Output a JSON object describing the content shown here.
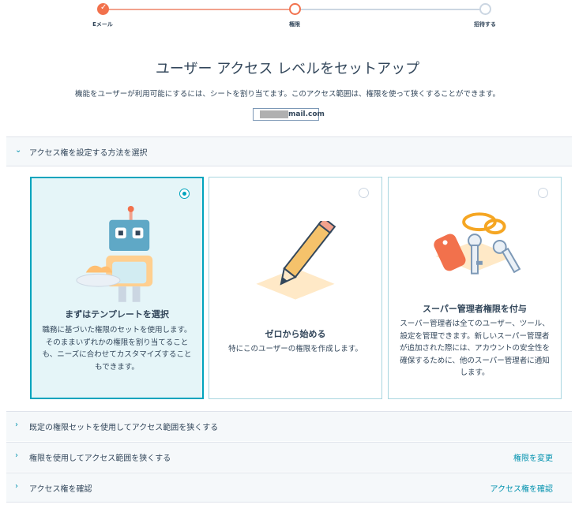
{
  "stepper": {
    "steps": [
      {
        "label": "Eメール",
        "state": "complete"
      },
      {
        "label": "権限",
        "state": "current"
      },
      {
        "label": "招待する",
        "state": "pending"
      }
    ],
    "check_glyph": "✓"
  },
  "header": {
    "title": "ユーザー アクセス レベルをセットアップ",
    "subtitle": "機能をユーザーが利用可能にするには、シートを割り当てます。このアクセス範囲は、権限を使って狭くすることができます。",
    "email": "mail.com"
  },
  "access_method_section": {
    "label": "アクセス権を設定する方法を選択",
    "chevron": "⌄"
  },
  "cards": [
    {
      "title": "まずはテンプレートを選択",
      "description": "職務に基づいた権限のセットを使用します。そのままいずれかの権限を割り当てることも、ニーズに合わせてカスタマイズすることもできます。",
      "selected": true,
      "icon": "robot-waiter-icon"
    },
    {
      "title": "ゼロから始める",
      "description": "特にこのユーザーの権限を作成します。",
      "selected": false,
      "icon": "pencil-icon"
    },
    {
      "title": "スーパー管理者権限を付与",
      "description": "スーパー管理者は全てのユーザー、ツール、設定を管理できます。新しいスーパー管理者が追加された際には、アカウントの安全性を確保するために、他のスーパー管理者に通知します。",
      "selected": false,
      "icon": "keys-icon"
    }
  ],
  "sections": [
    {
      "label": "既定の権限セットを使用してアクセス範囲を狭くする",
      "action": "",
      "chevron": "›"
    },
    {
      "label": "権限を使用してアクセス範囲を狭くする",
      "action": "権限を変更",
      "chevron": "›"
    },
    {
      "label": "アクセス権を確認",
      "action": "アクセス権を確認",
      "chevron": "›"
    }
  ],
  "colors": {
    "accent": "#00a4bd",
    "link": "#0091ae",
    "progress": "#f2714c",
    "text": "#33475b"
  }
}
